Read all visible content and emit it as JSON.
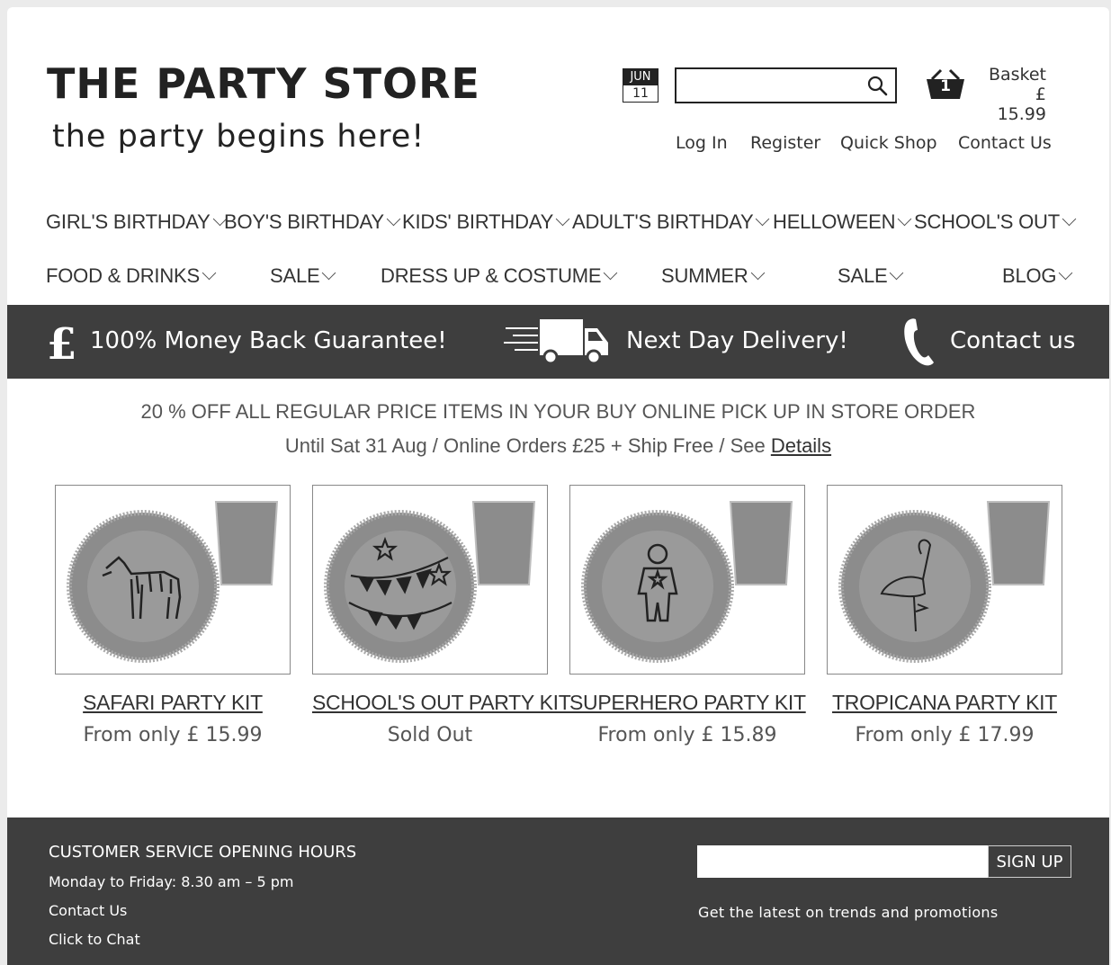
{
  "brand": {
    "title": "THE PARTY STORE",
    "tagline": "the party begins here!"
  },
  "date": {
    "month": "JUN",
    "day": "11"
  },
  "search": {
    "value": "",
    "placeholder": ""
  },
  "basket": {
    "count": "1",
    "label": "Basket",
    "total": "£ 15.99"
  },
  "top_links": [
    "Log In",
    "Register",
    "Quick Shop",
    "Contact Us"
  ],
  "nav": {
    "row1": [
      "GIRL'S BIRTHDAY",
      "BOY'S BIRTHDAY",
      "KIDS' BIRTHDAY",
      "ADULT'S BIRTHDAY",
      "HELLOWEEN",
      "SCHOOL'S OUT"
    ],
    "row2": [
      "FOOD & DRINKS",
      "SALE",
      "DRESS UP & COSTUME",
      "SUMMER",
      "SALE",
      "BLOG"
    ]
  },
  "banner": {
    "guarantee": "100% Money Back Guarantee!",
    "delivery": "Next Day Delivery!",
    "contact": "Contact us"
  },
  "promo": {
    "line1": "20 % OFF ALL REGULAR PRICE ITEMS IN YOUR BUY ONLINE PICK UP IN STORE ORDER",
    "line2": "Until Sat 31 Aug / Online Orders £25 + Ship Free  / See ",
    "details_link": "Details"
  },
  "products": [
    {
      "name": "SAFARI PARTY KIT",
      "price": "From only £ 15.99",
      "icon": "zebra-icon"
    },
    {
      "name": "SCHOOL'S OUT PARTY KIT",
      "price": "Sold Out",
      "icon": "bunting-icon"
    },
    {
      "name": "SUPERHERO PARTY KIT",
      "price": "From only £ 15.89",
      "icon": "superhero-icon"
    },
    {
      "name": "TROPICANA PARTY KIT",
      "price": "From only £ 17.99",
      "icon": "flamingo-icon"
    }
  ],
  "footer": {
    "heading": "CUSTOMER SERVICE OPENING HOURS",
    "hours": "Monday to Friday: 8.30 am – 5 pm",
    "contact": "Contact Us",
    "chat": "Click to Chat",
    "signup_label": "SIGN UP",
    "signup_placeholder": "",
    "note": "Get the latest on trends and promotions"
  },
  "colors": {
    "dark_band": "#3e3e3e",
    "plate": "#8c8c8c",
    "text": "#333333"
  }
}
